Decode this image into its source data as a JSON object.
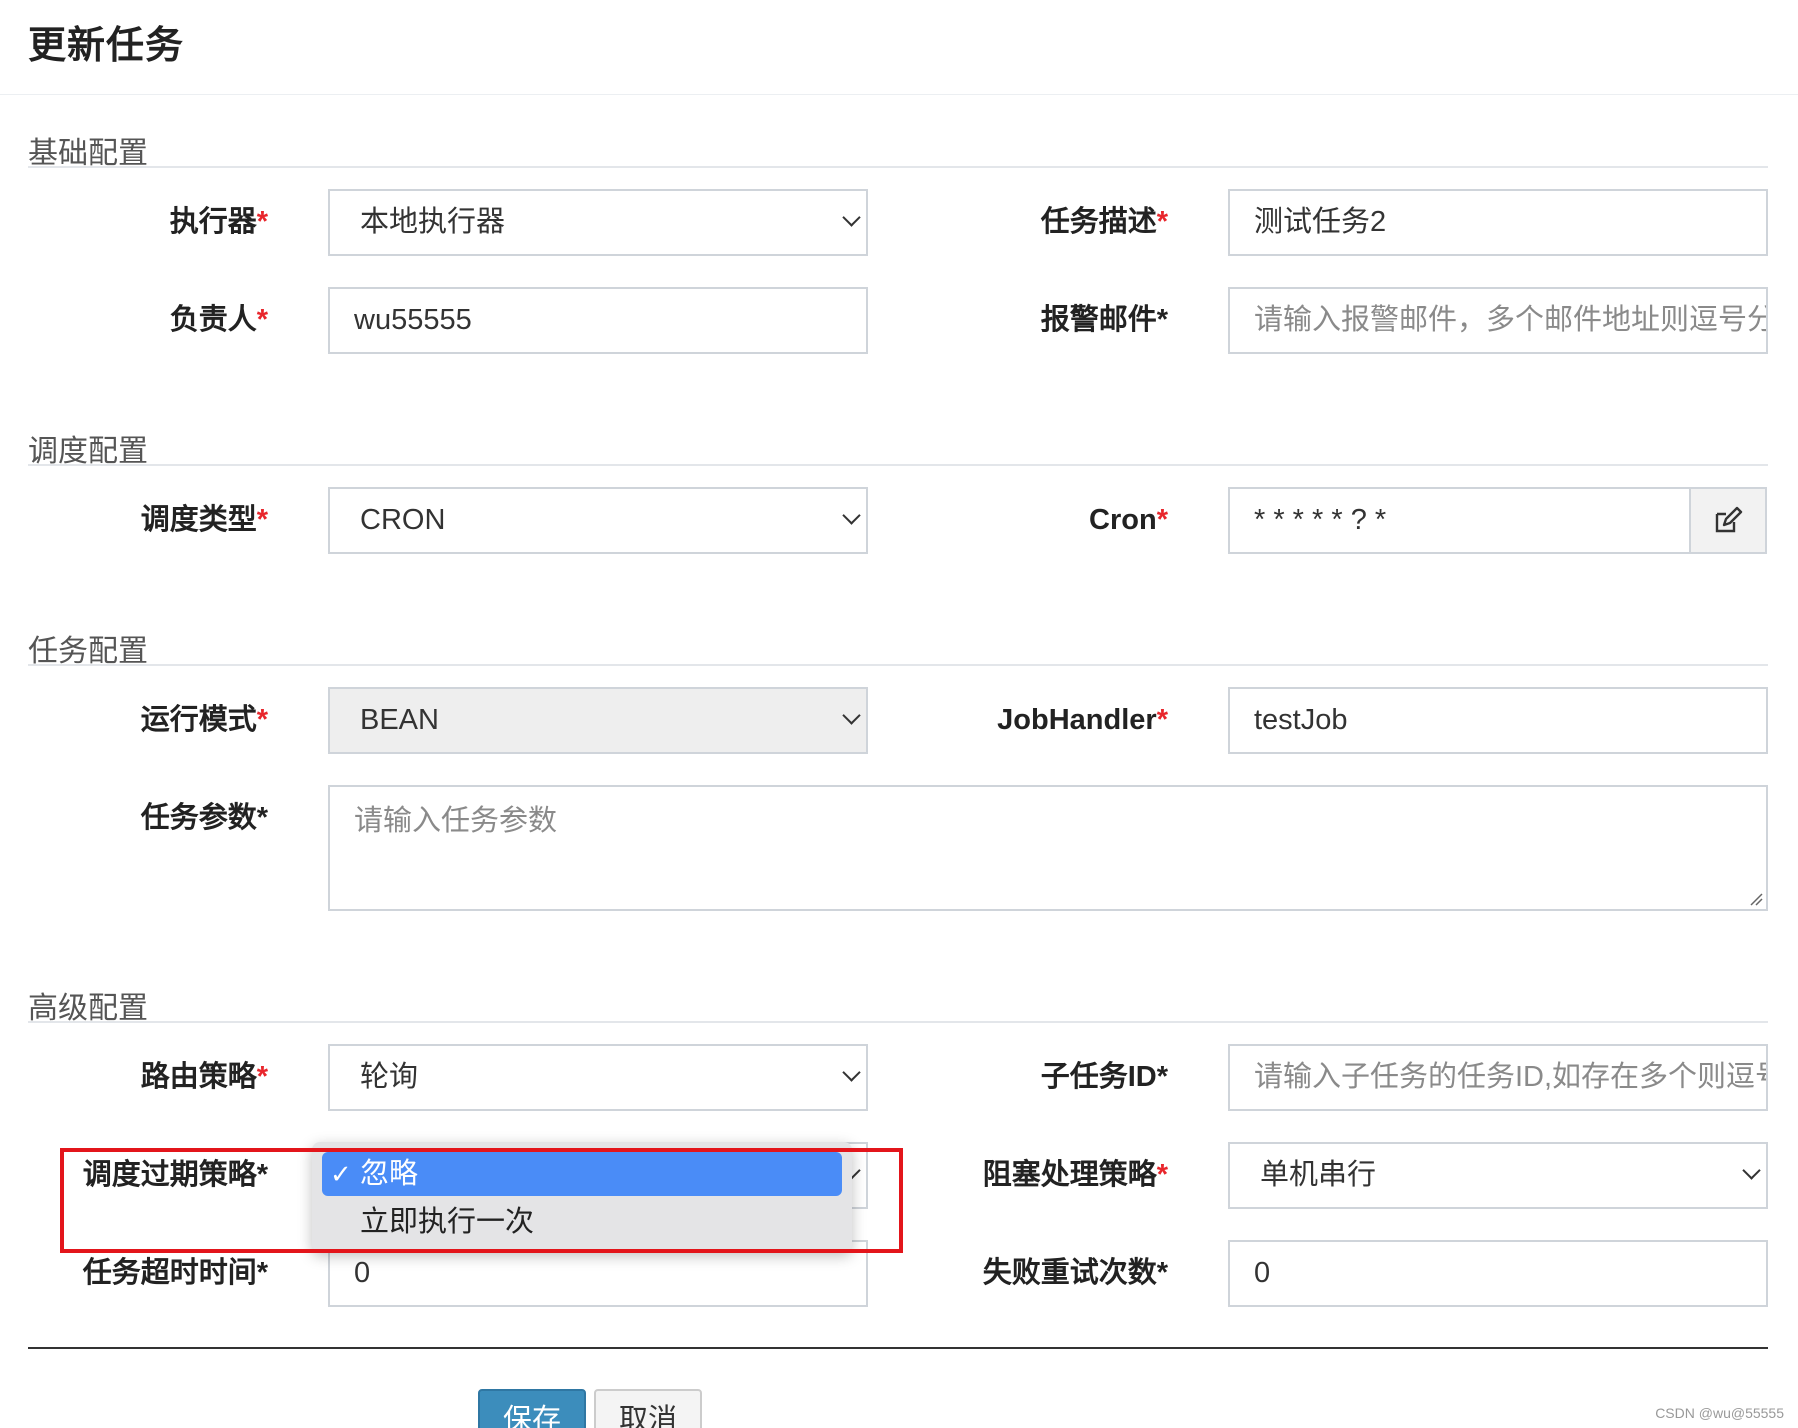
{
  "page": {
    "title": "更新任务"
  },
  "sections": {
    "basic": "基础配置",
    "schedule": "调度配置",
    "task": "任务配置",
    "advanced": "高级配置"
  },
  "fields": {
    "executor": {
      "label": "执行器",
      "value": "本地执行器"
    },
    "job_desc": {
      "label": "任务描述",
      "value": "测试任务2"
    },
    "author": {
      "label": "负责人",
      "value": "wu55555"
    },
    "alarm_email": {
      "label": "报警邮件",
      "placeholder": "请输入报警邮件，多个邮件地址则逗号分"
    },
    "schedule_type": {
      "label": "调度类型",
      "value": "CRON"
    },
    "cron": {
      "label": "Cron",
      "value": "* * * * * ? *"
    },
    "glue_type": {
      "label": "运行模式",
      "value": "BEAN"
    },
    "job_handler": {
      "label": "JobHandler",
      "value": "testJob"
    },
    "job_param": {
      "label": "任务参数",
      "placeholder": "请输入任务参数"
    },
    "route_strategy": {
      "label": "路由策略",
      "value": "轮询"
    },
    "child_job_id": {
      "label": "子任务ID",
      "placeholder": "请输入子任务的任务ID,如存在多个则逗号"
    },
    "misfire_strategy": {
      "label": "调度过期策略"
    },
    "block_strategy": {
      "label": "阻塞处理策略",
      "value": "单机串行"
    },
    "timeout": {
      "label": "任务超时时间",
      "value": "0"
    },
    "fail_retry": {
      "label": "失败重试次数",
      "value": "0"
    }
  },
  "misfire_dropdown": {
    "options": [
      {
        "label": "忽略",
        "selected": true
      },
      {
        "label": "立即执行一次",
        "selected": false
      }
    ],
    "check": "✓"
  },
  "buttons": {
    "save": "保存",
    "cancel": "取消"
  },
  "required_mark": "*",
  "watermark": "CSDN @wu@55555",
  "colors": {
    "primary": "#3c8dbc",
    "required": "#e8262c",
    "highlight": "#e3151b",
    "selected_option": "#4a8cf7"
  }
}
